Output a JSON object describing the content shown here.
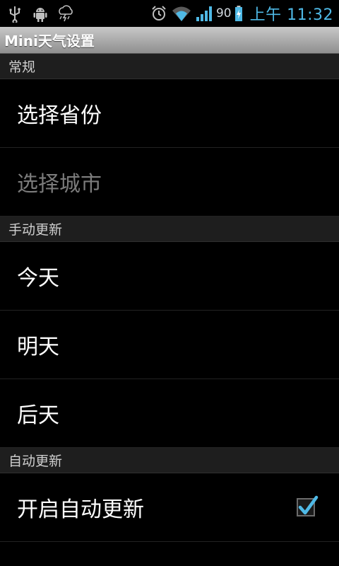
{
  "status_bar": {
    "left_icons": [
      "usb-icon",
      "android-debug-icon",
      "weather-storm-icon"
    ],
    "right_icons": [
      "alarm-icon",
      "wifi-icon",
      "signal-icon",
      "battery-charging-icon"
    ],
    "battery_percent": "90",
    "time": "上午 11:32",
    "accent_color": "#4fb9e6"
  },
  "title_bar": {
    "title": "Mini天气设置"
  },
  "sections": {
    "general": {
      "header": "常规",
      "items": [
        {
          "label": "选择省份",
          "enabled": true
        },
        {
          "label": "选择城市",
          "enabled": false
        }
      ]
    },
    "manual_update": {
      "header": "手动更新",
      "items": [
        {
          "label": "今天"
        },
        {
          "label": "明天"
        },
        {
          "label": "后天"
        }
      ]
    },
    "auto_update": {
      "header": "自动更新",
      "items": [
        {
          "label": "开启自动更新",
          "checked": true
        }
      ]
    }
  }
}
